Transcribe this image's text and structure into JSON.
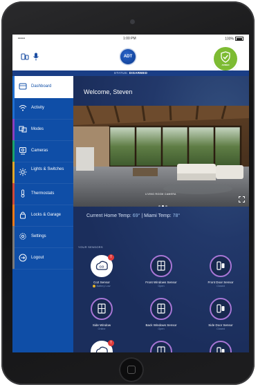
{
  "statusbar": {
    "carrier": "•••••",
    "signal_icon": "wifi-icon",
    "time": "1:00 PM",
    "battery": "100%"
  },
  "header": {
    "logo": "ADT",
    "status_badge": "ARMED",
    "left_icons": [
      "devices-icon",
      "microphone-icon"
    ]
  },
  "status_row": {
    "label": "STATUS:",
    "value": "DISARMED"
  },
  "sidebar": {
    "items": [
      {
        "label": "Dashboard",
        "icon": "dashboard-icon",
        "color": "#1f6fd1"
      },
      {
        "label": "Activity",
        "icon": "wifi-icon",
        "color": "#1f6fd1"
      },
      {
        "label": "Modes",
        "icon": "modes-icon",
        "color": "#8a3fc0"
      },
      {
        "label": "Cameras",
        "icon": "camera-icon",
        "color": "#1aa36a"
      },
      {
        "label": "Lights & Switches",
        "icon": "light-icon",
        "color": "#e0a72a"
      },
      {
        "label": "Thermostats",
        "icon": "thermometer-icon",
        "color": "#d04a3a"
      },
      {
        "label": "Locks & Garage",
        "icon": "lock-icon",
        "color": "#f07a1a"
      },
      {
        "label": "Settings",
        "icon": "gear-icon",
        "color": "#7a7a7a"
      },
      {
        "label": "Logout",
        "icon": "logout-icon",
        "color": "#7a7a7a"
      }
    ]
  },
  "main": {
    "welcome": "Welcome, Steven",
    "camera_caption": "LIVING ROOM CAMERA",
    "temps": {
      "home_label": "Current Home Temp:",
      "home_value": "69°",
      "sep": "|",
      "city_label": "Miami Temp:",
      "city_value": "78°"
    },
    "sensors_title": "YOUR SENSORS",
    "sensors": [
      {
        "name": "Co2 Sensor",
        "status": "Battery Low",
        "icon": "co2-icon",
        "alert": "!",
        "ring": "gold"
      },
      {
        "name": "Front Windows Sensor",
        "status": "Open",
        "icon": "window-icon",
        "ring": "purple"
      },
      {
        "name": "Front Door Sensor",
        "status": "Closed",
        "icon": "door-sensor-icon",
        "ring": "purple"
      },
      {
        "name": "Side Window",
        "status": "Online",
        "icon": "window-icon",
        "ring": "purple"
      },
      {
        "name": "Back Windows Sensor",
        "status": "Open",
        "icon": "window-icon",
        "ring": "purple"
      },
      {
        "name": "Side Door Sensor",
        "status": "Closed",
        "icon": "door-sensor-icon",
        "ring": "purple"
      }
    ],
    "camera_dots_active": 2,
    "camera_dots_total": 3
  },
  "colors": {
    "sidebar": "#0f4ea7",
    "main_bg": "#1b2e5c",
    "armed_green": "#7dbb33",
    "header_bar": "#1a3e86"
  }
}
